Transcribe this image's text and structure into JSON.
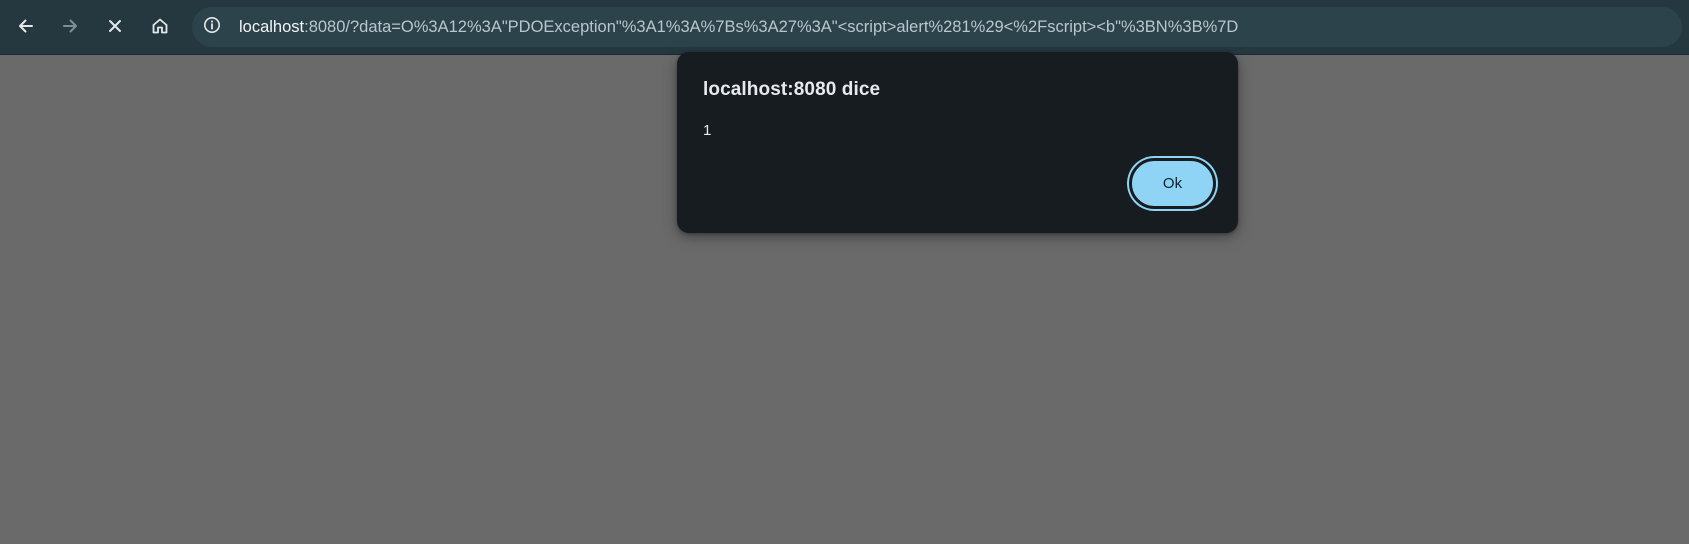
{
  "browser": {
    "url_host": "localhost",
    "url_rest": ":8080/?data=O%3A12%3A\"PDOException\"%3A1%3A%7Bs%3A27%3A\"<script>alert%281%29<%2Fscript><b\"%3BN%3B%7D",
    "icons": {
      "back": "arrow-left-icon",
      "forward": "arrow-right-icon",
      "stop": "close-icon",
      "home": "home-icon",
      "site_info": "info-icon"
    },
    "colors": {
      "toolbar_bg": "#253840",
      "omnibox_bg": "#2d434c",
      "page_overlay": "#6a6a6a"
    }
  },
  "dialog": {
    "title": "localhost:8080 dice",
    "message": "1",
    "ok_label": "Ok",
    "colors": {
      "background": "#171c20",
      "button": "#8fd4f5"
    }
  }
}
